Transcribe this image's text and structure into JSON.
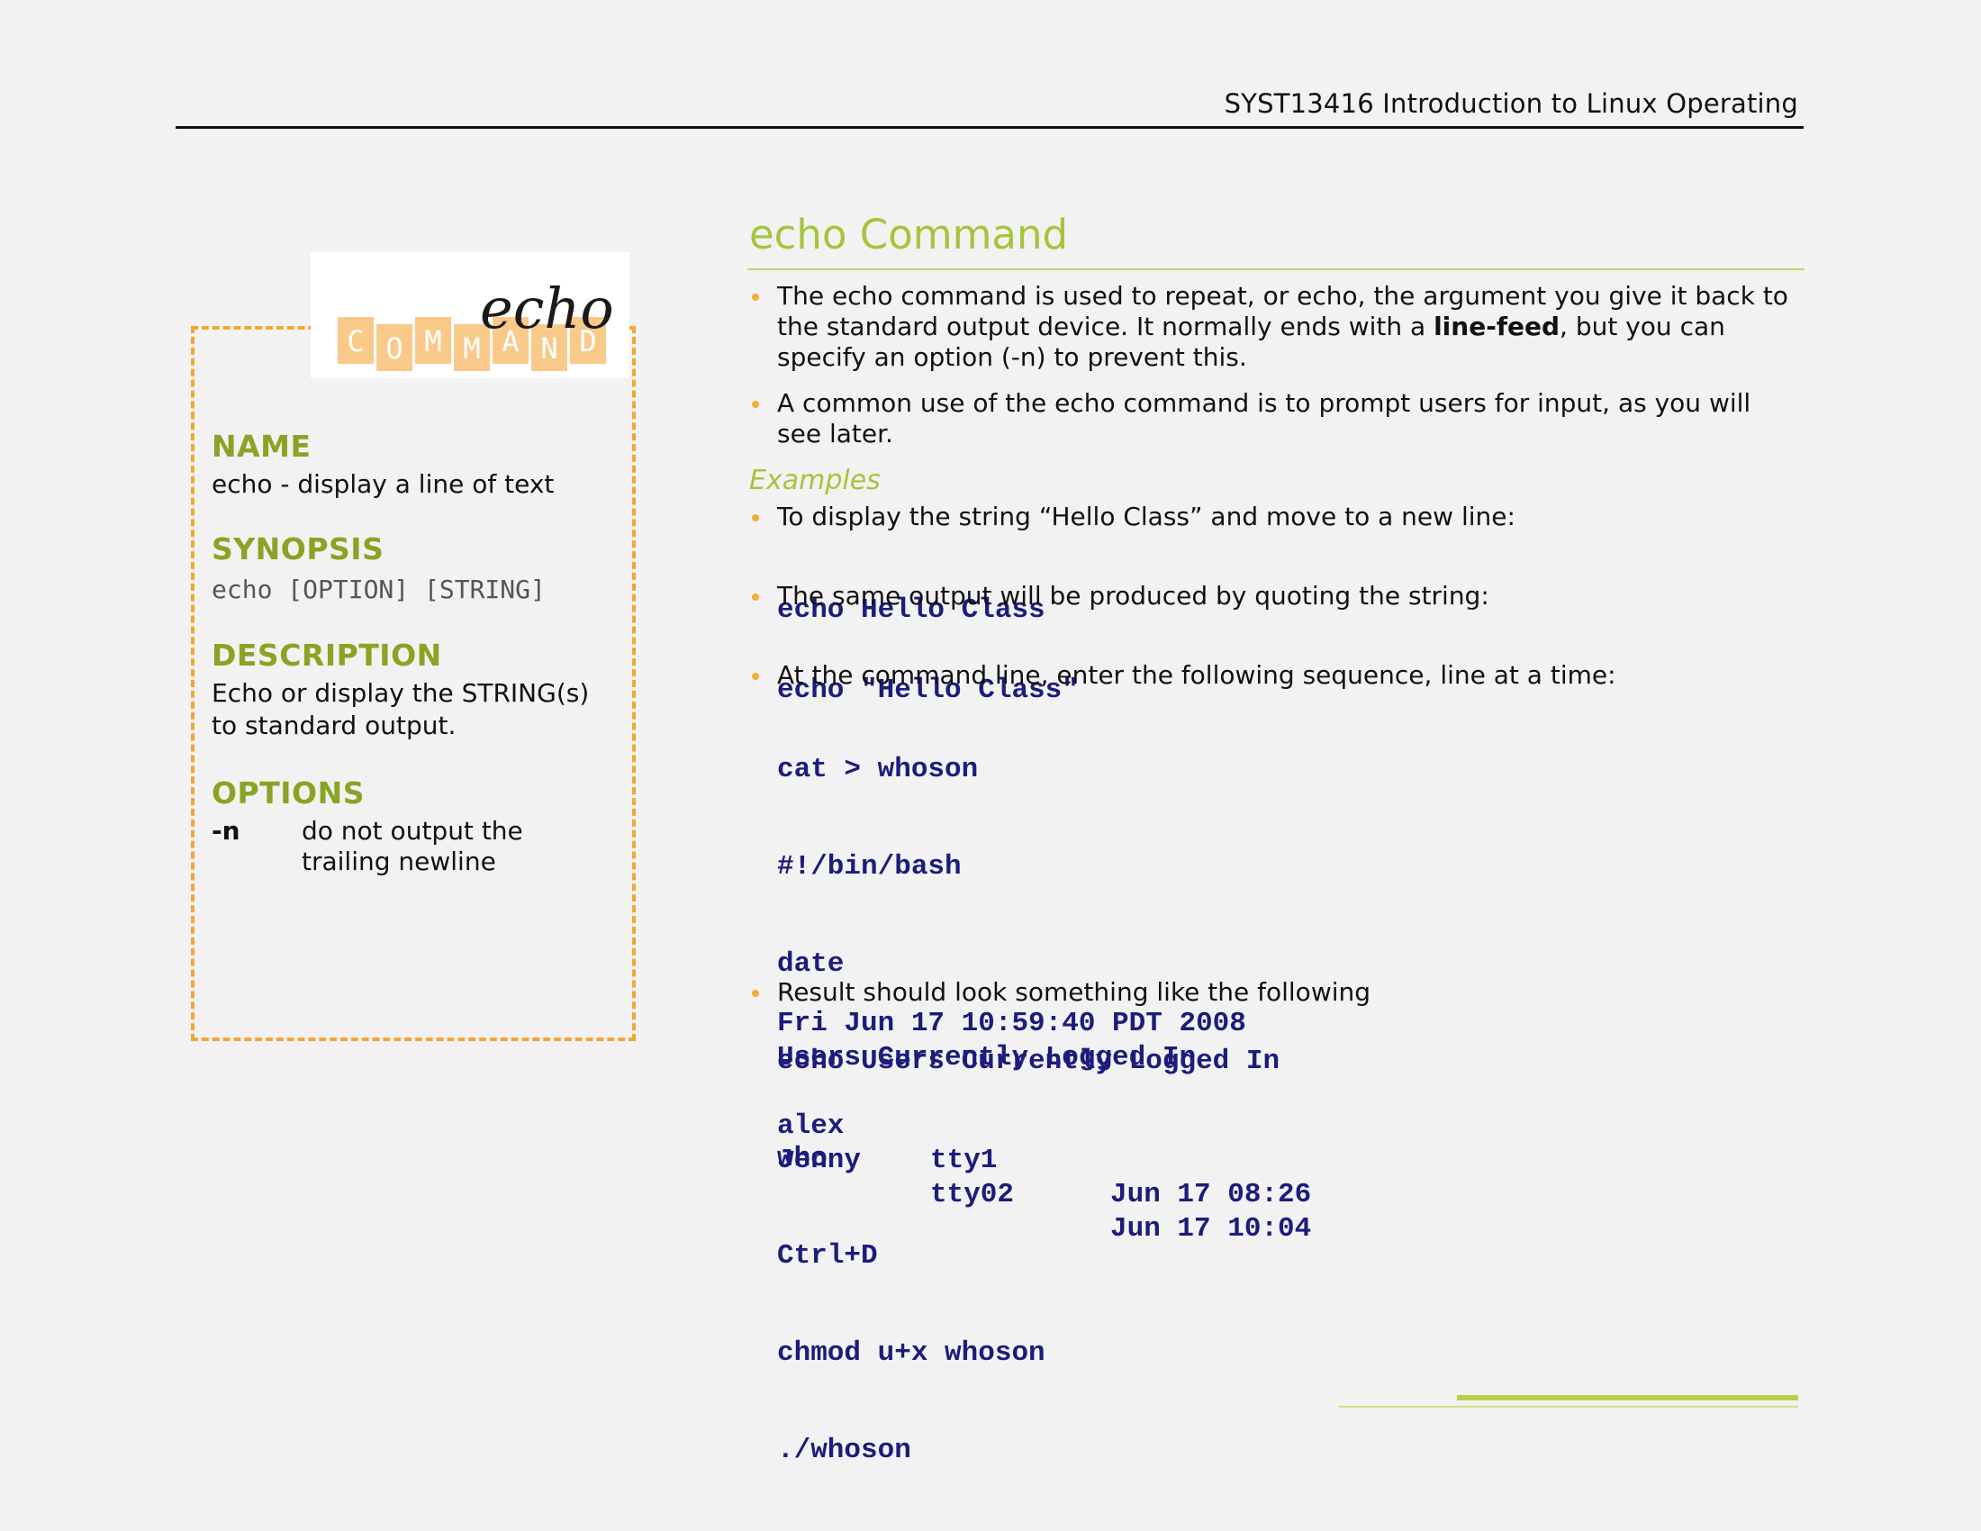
{
  "header": {
    "title": "SYST13416 Introduction to Linux Operating"
  },
  "sidebar": {
    "logo": {
      "script_word": "echo",
      "letters": [
        "C",
        "O",
        "M",
        "M",
        "A",
        "N",
        "D"
      ],
      "colors": {
        "tile": "#f9c98a",
        "letter": "#ffffff",
        "script": "#1a1a1a"
      }
    },
    "name_title": "NAME",
    "name_text": "echo - display a line of text",
    "synopsis_title": "SYNOPSIS",
    "synopsis_text": "echo [OPTION] [STRING]",
    "description_title": "DESCRIPTION",
    "description_line1": "Echo or display the STRING(s)",
    "description_line2": "to standard output.",
    "options_title": "OPTIONS",
    "option_flag": "-n",
    "option_desc_line1": "do not output the",
    "option_desc_line2": "trailing newline"
  },
  "main": {
    "title": "echo Command",
    "bullet1": {
      "line1": "The echo command is used to repeat, or echo, the argument you give it back to",
      "line2_before": "the standard output device. It normally ends with a ",
      "line2_bold": "line-feed",
      "line2_after": ", but you can",
      "line3": "specify an option (-n) to prevent this."
    },
    "bullet2": {
      "line1": "A common use of the echo command is to prompt users for input, as you will",
      "line2": "see later."
    },
    "examples_label": "Examples",
    "example1": {
      "text": "To display the string “Hello Class” and move to a new line:",
      "code": "echo Hello Class"
    },
    "example2": {
      "text": "The same output will be produced by quoting the string:",
      "code": "echo \"Hello Class\""
    },
    "example3": {
      "text": "At the command line, enter the following sequence, line at a time:",
      "code": [
        "cat > whoson",
        "#!/bin/bash",
        "date",
        "echo Users Currently Logged In",
        "who",
        "Ctrl+D",
        "chmod u+x whoson",
        "./whoson"
      ]
    },
    "example4": {
      "text": "Result should look something like the following",
      "line1": "Fri Jun 17 10:59:40 PDT 2008",
      "line2": "Users Currently Logged In",
      "rows": [
        {
          "user": "alex",
          "tty": "tty1",
          "time": "Jun 17 08:26"
        },
        {
          "user": "Jenny",
          "tty": "tty02",
          "time": "Jun 17 10:04"
        }
      ]
    }
  },
  "colors": {
    "accent_green": "#a7c43a",
    "section_green": "#8aa324",
    "bullet_orange": "#f0b030",
    "card_border": "#f0a830",
    "code_navy": "#1c1c7c",
    "background": "#f2f2f2"
  }
}
